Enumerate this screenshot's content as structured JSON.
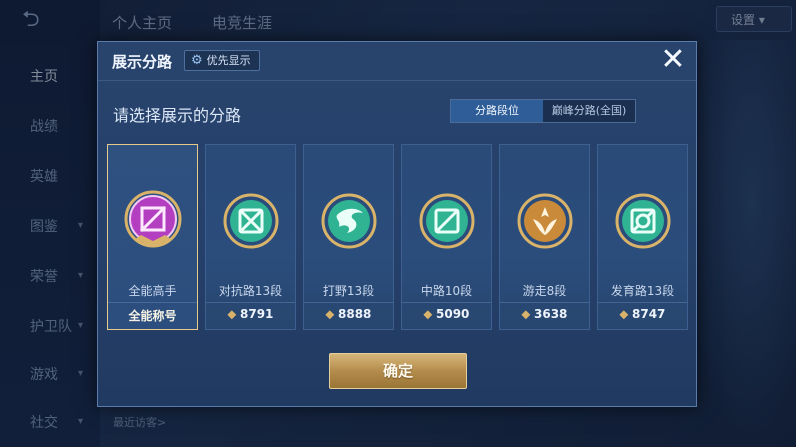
{
  "background": {
    "back_symbol": "⮌",
    "top_tabs": [
      "个人主页",
      "电竞生涯"
    ],
    "settings_label": "设置",
    "nav": [
      {
        "label": "主页",
        "active": true
      },
      {
        "label": "战绩",
        "active": false
      },
      {
        "label": "英雄",
        "active": false
      },
      {
        "label": "图鉴",
        "active": false
      },
      {
        "label": "荣誉",
        "active": false
      },
      {
        "label": "护卫队",
        "active": false
      },
      {
        "label": "游戏",
        "active": false
      },
      {
        "label": "社交",
        "active": false
      }
    ],
    "recent_visitors_label": "最近访客>"
  },
  "dialog": {
    "title": "展示分路",
    "priority_button": {
      "icon": "gear-icon",
      "label": "优先显示"
    },
    "close_label": "✕",
    "subtitle": "请选择展示的分路",
    "mode_toggle": {
      "options": [
        "分路段位",
        "巅峰分路(全国)"
      ],
      "selected_index": 0
    },
    "cards": [
      {
        "name": "全能高手",
        "score": "全能称号",
        "emblem": "all-round-emblem",
        "selected": true,
        "show_points_icon": false
      },
      {
        "name": "对抗路13段",
        "score": "8791",
        "emblem": "clash-lane-emblem",
        "selected": false,
        "show_points_icon": true
      },
      {
        "name": "打野13段",
        "score": "8888",
        "emblem": "jungle-emblem",
        "selected": false,
        "show_points_icon": true
      },
      {
        "name": "中路10段",
        "score": "5090",
        "emblem": "mid-lane-emblem",
        "selected": false,
        "show_points_icon": true
      },
      {
        "name": "游走8段",
        "score": "3638",
        "emblem": "roam-emblem",
        "selected": false,
        "show_points_icon": true
      },
      {
        "name": "发育路13段",
        "score": "8747",
        "emblem": "farm-lane-emblem",
        "selected": false,
        "show_points_icon": true
      }
    ],
    "confirm_label": "确定"
  },
  "colors": {
    "accent_gold": "#d9b36a",
    "selected_border": "#e7c98a",
    "jade": "#3fc7a6",
    "all_round_purple": "#b43ec0"
  }
}
